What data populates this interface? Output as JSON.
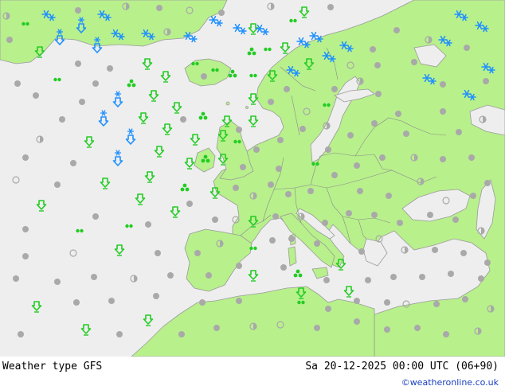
{
  "footer": {
    "left_label": "Weather type   GFS",
    "right_label": "Sa 20-12-2025 00:00 UTC (06+90)",
    "credit": "©weatheronline.co.uk"
  },
  "colors": {
    "sea": "#eeeeee",
    "land": "#b8f08c",
    "border": "#8a8a8a",
    "coast": "#9a9a9a",
    "rain": "#22cc22",
    "snow": "#1e90ff",
    "cloud": "#a9a9a9"
  },
  "legend_icons": {
    "rain": "rain-arrow-icon",
    "shower": "shower-cluster-icon",
    "drizzle": "drizzle-dots-icon",
    "snow": "snowflake-icon",
    "snow_rain": "sleet-arrow-icon",
    "cloudy": "cloud-dot-icon",
    "partly": "partly-cloud-icon"
  }
}
